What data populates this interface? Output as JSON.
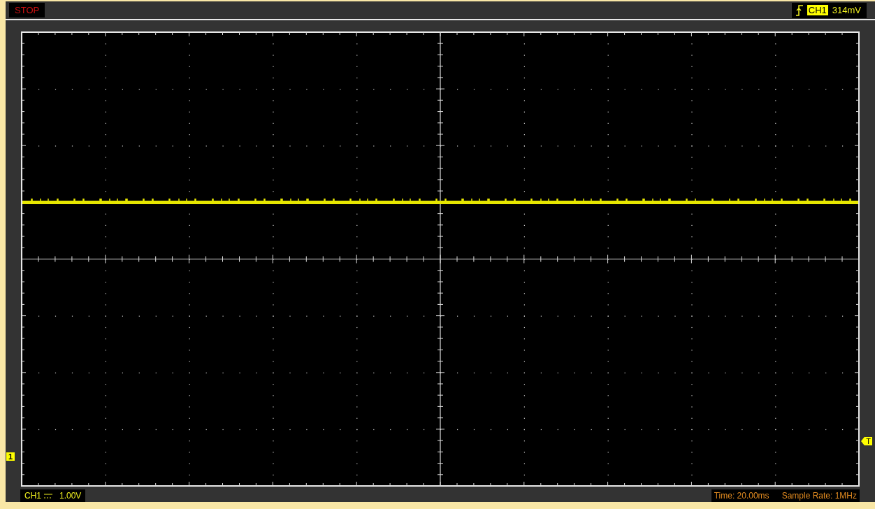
{
  "status": {
    "label": "STOP"
  },
  "trigger": {
    "channel": "CH1",
    "level": "314mV"
  },
  "markers": {
    "channel": "1",
    "trigger": "T"
  },
  "channel_info": {
    "channel": "CH1",
    "volts_per_div": "1.00V"
  },
  "timebase": {
    "time": "Time: 20.00ms",
    "sample_rate": "Sample Rate: 1MHz"
  }
}
